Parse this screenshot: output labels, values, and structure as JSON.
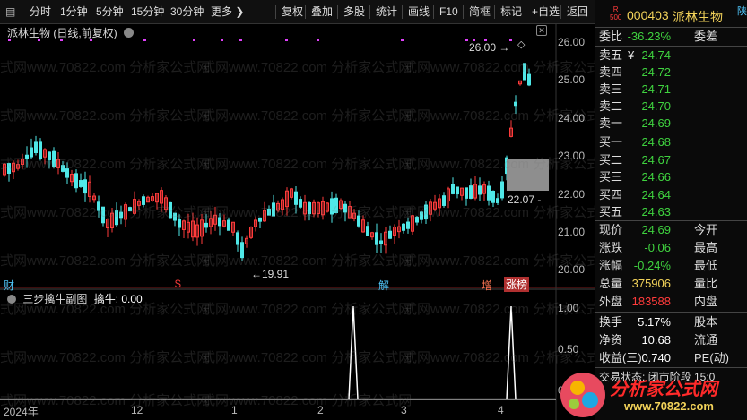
{
  "toolbar": {
    "items": [
      "分时",
      "1分钟",
      "5分钟",
      "15分钟",
      "30分钟",
      "更多",
      "复权",
      "叠加",
      "多股",
      "统计",
      "画线",
      "F10",
      "简框",
      "标记",
      "+自选",
      "返回"
    ]
  },
  "chart": {
    "title": "派林生物 (日线,前复权)",
    "high_label": "26.00",
    "low_label": "19.91",
    "last_label": "22.07",
    "yaxis": [
      "26.00",
      "25.00",
      "24.00",
      "23.00",
      "22.00",
      "21.00",
      "20.00"
    ],
    "markers": [
      "财",
      "$",
      "解",
      "增",
      "涨榜"
    ]
  },
  "sub_chart": {
    "title": "三步擒牛副图",
    "value_label": "擒牛: 0.00",
    "yaxis": [
      "1.00",
      "0.50",
      "0.00"
    ]
  },
  "xaxis": [
    "2024年",
    "12",
    "1",
    "2",
    "3",
    "4"
  ],
  "watermark": "式网www.70822.com 分析家公式网",
  "quote": {
    "code": "000403",
    "name": "派林生物",
    "r_badge": "R",
    "r_num": "500",
    "tail": "陕",
    "webi_label": "委比",
    "webi_value": "-36.23%",
    "wecha_label": "委差",
    "sells": [
      {
        "label": "卖五",
        "price": "24.74",
        "mark": "¥"
      },
      {
        "label": "卖四",
        "price": "24.72",
        "mark": ""
      },
      {
        "label": "卖三",
        "price": "24.71",
        "mark": ""
      },
      {
        "label": "卖二",
        "price": "24.70",
        "mark": ""
      },
      {
        "label": "卖一",
        "price": "24.69",
        "mark": ""
      }
    ],
    "buys": [
      {
        "label": "买一",
        "price": "24.68"
      },
      {
        "label": "买二",
        "price": "24.67"
      },
      {
        "label": "买三",
        "price": "24.66"
      },
      {
        "label": "买四",
        "price": "24.64"
      },
      {
        "label": "买五",
        "price": "24.63"
      }
    ],
    "stats": [
      {
        "label": "现价",
        "value": "24.69",
        "color": "green",
        "label2": "今开"
      },
      {
        "label": "涨跌",
        "value": "-0.06",
        "color": "green",
        "label2": "最高"
      },
      {
        "label": "涨幅",
        "value": "-0.24%",
        "color": "green",
        "label2": "最低"
      },
      {
        "label": "总量",
        "value": "375906",
        "color": "yellow",
        "label2": "量比"
      },
      {
        "label": "外盘",
        "value": "183588",
        "color": "red",
        "label2": "内盘"
      }
    ],
    "stats2": [
      {
        "label": "换手",
        "value": "5.17%",
        "label2": "股本"
      },
      {
        "label": "净资",
        "value": "10.68",
        "label2": "流通"
      },
      {
        "label": "收益(三)",
        "value": "0.740",
        "label2": "PE(动)"
      }
    ],
    "bottom_text": "交易状态: 闭市阶段 15:0"
  },
  "logo": {
    "text": "分析家公式网",
    "url": "www.70822.com"
  }
}
